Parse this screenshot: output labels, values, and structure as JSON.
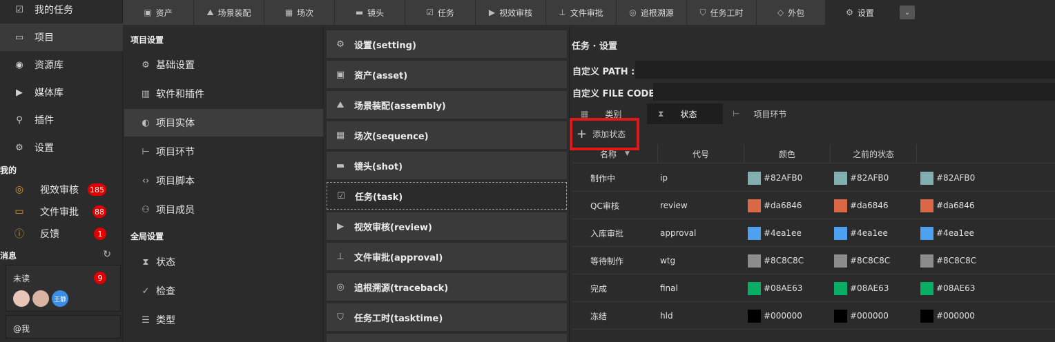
{
  "sidebar": {
    "nav": [
      {
        "label": "我的任务",
        "icon": "checkbox-icon"
      },
      {
        "label": "项目",
        "icon": "window-icon"
      },
      {
        "label": "资源库",
        "icon": "globe-icon"
      },
      {
        "label": "媒体库",
        "icon": "play-icon"
      },
      {
        "label": "插件",
        "icon": "plug-icon"
      },
      {
        "label": "设置",
        "icon": "gear-icon"
      }
    ],
    "mine_label": "我的",
    "mine": [
      {
        "label": "视效审核",
        "count": "185",
        "icon": "eye-icon"
      },
      {
        "label": "文件审批",
        "count": "88",
        "icon": "folder-icon"
      },
      {
        "label": "反馈",
        "count": "1",
        "icon": "info-icon"
      }
    ],
    "messages_label": "消息",
    "unread_label": "未读",
    "unread_count": "9",
    "avatar_name": "王静",
    "at_me": "@我"
  },
  "tabs": [
    {
      "label": "资产",
      "icon": "asset-icon"
    },
    {
      "label": "场景装配",
      "icon": "mountain-icon"
    },
    {
      "label": "场次",
      "icon": "grid-icon"
    },
    {
      "label": "镜头",
      "icon": "clapper-icon"
    },
    {
      "label": "任务",
      "icon": "checkbox-icon"
    },
    {
      "label": "视效审核",
      "icon": "play-icon"
    },
    {
      "label": "文件审批",
      "icon": "stamp-icon"
    },
    {
      "label": "追根溯源",
      "icon": "target-icon"
    },
    {
      "label": "任务工时",
      "icon": "shield-icon"
    },
    {
      "label": "外包",
      "icon": "handshake-icon"
    },
    {
      "label": "设置",
      "icon": "gear-icon"
    }
  ],
  "settings_menu": {
    "project_label": "项目设置",
    "project_items": [
      {
        "label": "基础设置",
        "icon": "gear-icon"
      },
      {
        "label": "软件和插件",
        "icon": "bar-chart-icon"
      },
      {
        "label": "项目实体",
        "icon": "entity-icon"
      },
      {
        "label": "项目环节",
        "icon": "flow-icon"
      },
      {
        "label": "项目脚本",
        "icon": "code-icon"
      },
      {
        "label": "项目成员",
        "icon": "users-icon"
      }
    ],
    "global_label": "全局设置",
    "global_items": [
      {
        "label": "状态",
        "icon": "hourglass-icon"
      },
      {
        "label": "检查",
        "icon": "check-circle-icon"
      },
      {
        "label": "类型",
        "icon": "list-icon"
      }
    ]
  },
  "entities": [
    {
      "label": "设置(setting)",
      "icon": "gear-icon"
    },
    {
      "label": "资产(asset)",
      "icon": "asset-icon"
    },
    {
      "label": "场景装配(assembly)",
      "icon": "mountain-icon"
    },
    {
      "label": "场次(sequence)",
      "icon": "grid-icon"
    },
    {
      "label": "镜头(shot)",
      "icon": "clapper-icon"
    },
    {
      "label": "任务(task)",
      "icon": "checkbox-icon"
    },
    {
      "label": "视效审核(review)",
      "icon": "play-icon"
    },
    {
      "label": "文件审批(approval)",
      "icon": "stamp-icon"
    },
    {
      "label": "追根溯源(traceback)",
      "icon": "target-icon"
    },
    {
      "label": "任务工时(tasktime)",
      "icon": "shield-icon"
    }
  ],
  "panel": {
    "title": "任务 · 设置",
    "path_label": "自定义 PATH :",
    "filecode_label": "自定义 FILE CODE:",
    "subtabs": [
      {
        "label": "类别",
        "icon": "grid-icon"
      },
      {
        "label": "状态",
        "icon": "hourglass-icon"
      },
      {
        "label": "项目环节",
        "icon": "flow-icon"
      }
    ],
    "add_label": "添加状态",
    "columns": [
      "名称",
      "代号",
      "颜色",
      "之前的状态"
    ],
    "rows": [
      {
        "name": "制作中",
        "code": "ip",
        "color": "#82AFB0"
      },
      {
        "name": "QC审核",
        "code": "review",
        "color": "#da6846"
      },
      {
        "name": "入库审批",
        "code": "approval",
        "color": "#4ea1ee"
      },
      {
        "name": "等待制作",
        "code": "wtg",
        "color": "#8C8C8C"
      },
      {
        "name": "完成",
        "code": "final",
        "color": "#08AE63"
      },
      {
        "name": "冻结",
        "code": "hld",
        "color": "#000000"
      }
    ]
  }
}
